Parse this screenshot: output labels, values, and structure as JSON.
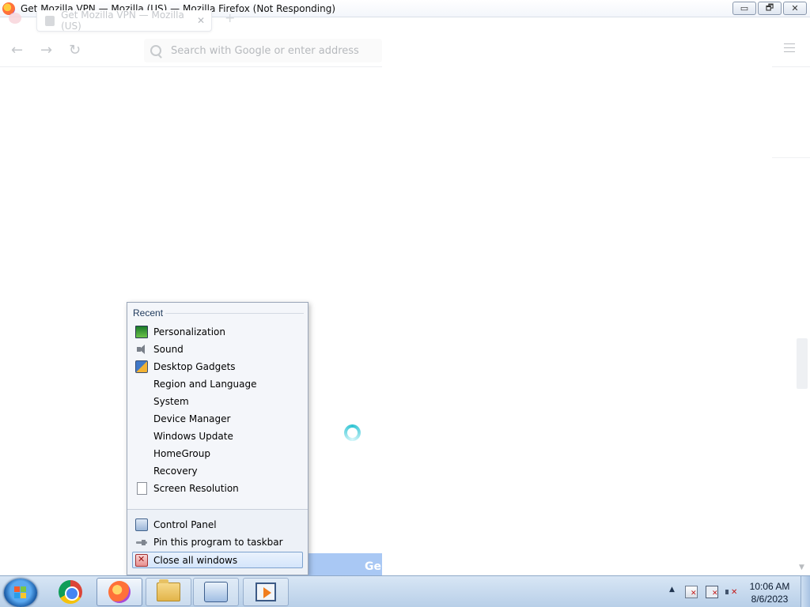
{
  "window": {
    "title": "Get Mozilla VPN — Mozilla (US) — Mozilla Firefox (Not Responding)",
    "controls": {
      "minimize": "▭",
      "maximize": "🗗",
      "close": "✕"
    }
  },
  "browser": {
    "tab_title": "Get Mozilla VPN — Mozilla (US)",
    "tab_close": "✕",
    "new_tab": "+",
    "nav": {
      "back": "←",
      "forward": "→",
      "reload": "↻"
    },
    "urlbar_placeholder": "Search with Google or enter address",
    "cta_partial": "Ge"
  },
  "jumplist": {
    "heading": "Recent",
    "recent_items": [
      {
        "label": "Personalization",
        "icon": "personalization-icon"
      },
      {
        "label": "Sound",
        "icon": "speaker-icon"
      },
      {
        "label": "Desktop Gadgets",
        "icon": "gadgets-icon"
      },
      {
        "label": "Region and Language",
        "icon": ""
      },
      {
        "label": "System",
        "icon": ""
      },
      {
        "label": "Device Manager",
        "icon": ""
      },
      {
        "label": "Windows Update",
        "icon": ""
      },
      {
        "label": "HomeGroup",
        "icon": ""
      },
      {
        "label": "Recovery",
        "icon": ""
      },
      {
        "label": "Screen Resolution",
        "icon": "document-icon"
      }
    ],
    "tasks": [
      {
        "label": "Control Panel",
        "icon": "control-panel-icon"
      },
      {
        "label": "Pin this program to taskbar",
        "icon": "pin-icon"
      },
      {
        "label": "Close all windows",
        "icon": "close-windows-icon",
        "highlighted": true
      }
    ]
  },
  "taskbar": {
    "buttons": [
      "chrome-icon",
      "firefox-icon",
      "folder-icon",
      "control-panel-icon",
      "media-player-icon"
    ],
    "tray_arrow": "▲",
    "clock": {
      "time": "10:06 AM",
      "date": "8/6/2023"
    }
  }
}
